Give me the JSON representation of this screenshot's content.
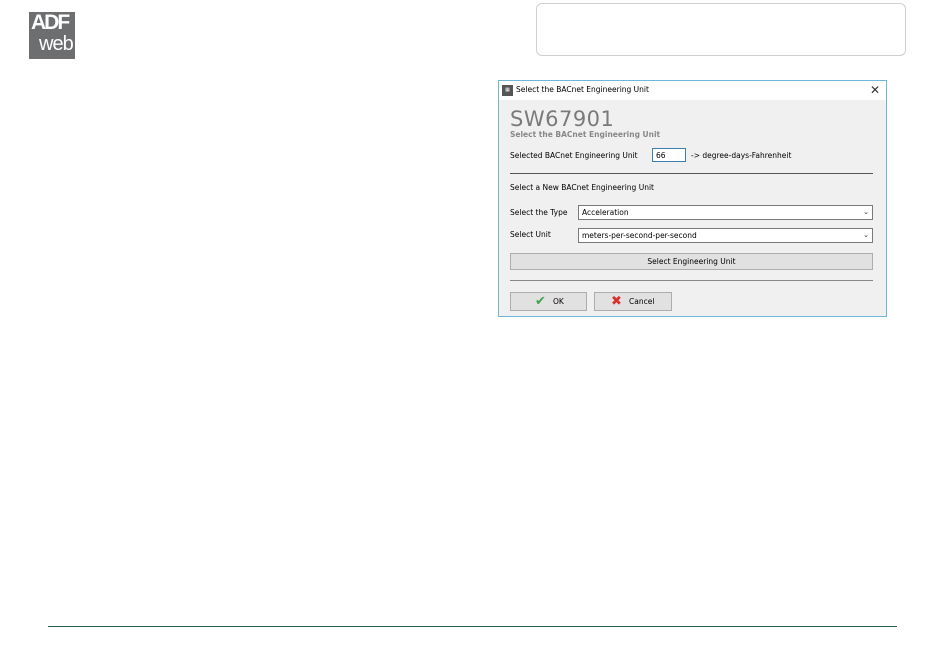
{
  "logo": {
    "line1": "ADF",
    "line2": "web"
  },
  "dialog": {
    "window_title": "Select the BACnet Engineering Unit",
    "heading": "SW67901",
    "subheading": "Select the BACnet Engineering Unit",
    "selected_label": "Selected BACnet Engineering Unit",
    "selected_value": "66",
    "selected_unit_text": "-> degree-days-Fahrenheit",
    "new_section_label": "Select a New BACnet Engineering Unit",
    "type_label": "Select the Type",
    "type_value": "Acceleration",
    "unit_label": "Select Unit",
    "unit_value": "meters-per-second-per-second",
    "select_button": "Select Engineering Unit",
    "ok_button": "OK",
    "cancel_button": "Cancel"
  }
}
